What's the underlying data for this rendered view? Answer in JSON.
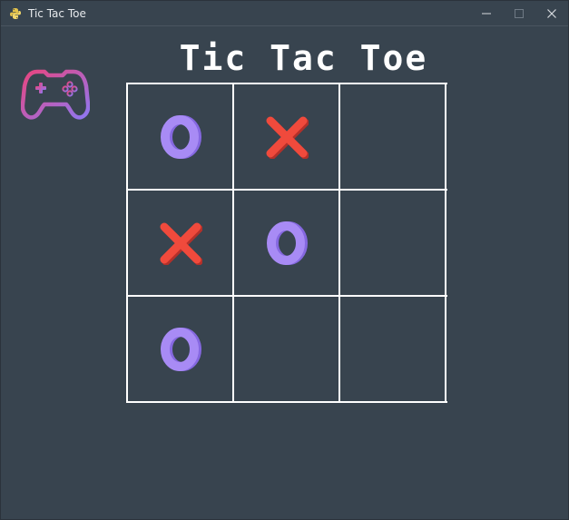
{
  "window": {
    "title": "Tic Tac Toe",
    "app_icon": "python-icon",
    "controls": [
      "minimize-icon",
      "maximize-icon",
      "close-icon"
    ]
  },
  "game": {
    "heading": "Tic Tac Toe",
    "logo_icon": "gamepad-icon",
    "board": [
      [
        "O",
        "X",
        ""
      ],
      [
        "X",
        "O",
        ""
      ],
      [
        "O",
        "",
        ""
      ]
    ]
  },
  "colors": {
    "background": "#38444f",
    "grid": "#ffffff",
    "x_mark": "#f04a3c",
    "o_mark": "#a88bf5",
    "logo_gradient_start": "#e8457f",
    "logo_gradient_end": "#8f77f2"
  }
}
